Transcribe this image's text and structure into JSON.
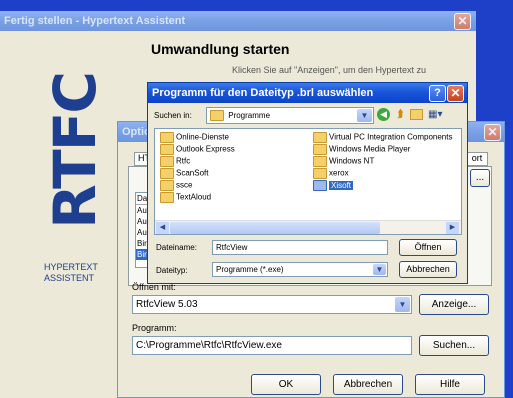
{
  "assistant": {
    "title": "Fertig stellen - Hypertext Assistent",
    "heading": "Umwandlung starten",
    "hint": "Klicken Sie auf \"Anzeigen\", um den Hypertext zu",
    "logo_text": "RTFC",
    "side_label_1": "HYPERTEXT",
    "side_label_2": "ASSISTENT"
  },
  "options": {
    "title": "Optionen",
    "tab_left": "HT",
    "tab_right": "ort",
    "list_items": [
      "Da",
      "Aus",
      "Aus",
      "Aus",
      "Bir",
      "Bin"
    ],
    "open_with_label": "Öffnen mit:",
    "viewer_value": "RtfcView 5.03",
    "show_button": "Anzeige...",
    "program_label": "Programm:",
    "program_value": "C:\\Programme\\Rtfc\\RtfcView.exe",
    "search_button": "Suchen...",
    "ok_button": "OK",
    "cancel_button": "Abbrechen",
    "help_button": "Hilfe",
    "right_button": "..."
  },
  "dialog": {
    "title": "Programm für den Dateityp .brl auswählen",
    "lookin_label": "Suchen in:",
    "lookin_value": "Programme",
    "files_left": [
      "Online-Dienste",
      "Outlook Express",
      "Rtfc",
      "ScanSoft",
      "ssce",
      "TextAloud"
    ],
    "files_right": [
      "Virtual PC Integration Components",
      "Windows Media Player",
      "Windows NT",
      "xerox",
      "Xisoft"
    ],
    "selected_file": "Xisoft",
    "filename_label": "Dateiname:",
    "filename_value": "RtfcView",
    "filetype_label": "Dateityp:",
    "filetype_value": "Programme (*.exe)",
    "open_button": "Öffnen",
    "cancel_button": "Abbrechen"
  },
  "colors": {
    "desktop": "#1e40c8",
    "selection": "#316ac5"
  }
}
